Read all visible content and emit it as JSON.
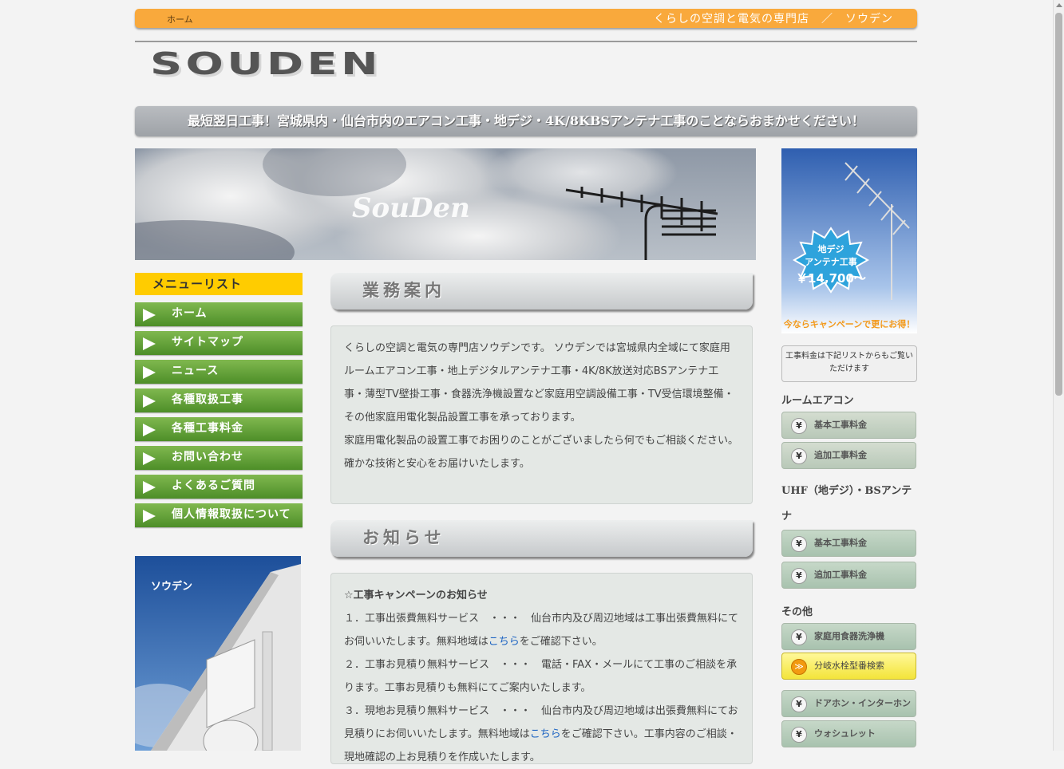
{
  "topbar": {
    "home_link": "ホーム",
    "tagline": "くらしの空調と電気の専門店　／　ソウデン"
  },
  "logo": {
    "text": "SOUDEN"
  },
  "banner": {
    "text": "最短翌日工事！宮城県内・仙台市内のエアコン工事・地デジ・4K/8KBSアンテナ工事のことならおまかせください！"
  },
  "hero": {
    "brand": "SouDen"
  },
  "menu": {
    "title": "メニューリスト",
    "items": [
      "ホーム",
      "サイトマップ",
      "ニュース",
      "各種取扱工事",
      "各種工事料金",
      "お問い合わせ",
      "よくあるご質問",
      "個人情報取扱について"
    ]
  },
  "side_photo": {
    "label": "ソウデン"
  },
  "business": {
    "heading": "業務案内",
    "para1": "くらしの空調と電気の専門店ソウデンです。 ソウデンでは宮城県内全域にて家庭用ルームエアコン工事・地上デジタルアンテナ工事・4K/8K放送対応BSアンテナ工事・薄型TV壁掛工事・食器洗浄機設置など家庭用空調設備工事・TV受信環境整備・その他家庭用電化製品設置工事を承っております。",
    "para2": "家庭用電化製品の設置工事でお困りのことがございましたら何でもご相談ください。",
    "para3": "確かな技術と安心をお届けいたします。"
  },
  "news": {
    "heading": "お知らせ",
    "title": "☆工事キャンペーンのお知らせ",
    "item1_before": "１．工事出張費無料サービス　・・・　仙台市内及び周辺地域は工事出張費無料にてお伺いいたします。無料地域は",
    "item1_link": "こちら",
    "item1_after": "をご確認下さい。",
    "item2": "２．工事お見積り無料サービス　・・・　電話・FAX・メールにて工事のご相談を承ります。工事お見積りも無料にてご案内いたします。",
    "item3_before": "３．現地お見積り無料サービス　・・・　仙台市内及び周辺地域は出張費無料にてお見積りにお伺いいたします。無料地域は",
    "item3_link": "こちら",
    "item3_after": "をご確認下さい。工事内容のご相談・現地確認の上お見積りを作成いたします。"
  },
  "ad": {
    "line1": "地デジ",
    "line2": "アンテナ工事",
    "price": "￥14,700～",
    "campaign": "今ならキャンペーンで更にお得！"
  },
  "right": {
    "info": "工事料金は下記リストからもご覧いただけます",
    "aircon_heading": "ルームエアコン",
    "aircon_basic": "基本工事料金",
    "aircon_extra": "追加工事料金",
    "uhf_heading": "UHF（地デジ）・BSアンテナ",
    "uhf_basic": "基本工事料金",
    "uhf_extra": "追加工事料金",
    "other_heading": "その他",
    "dishwasher": "家庭用食器洗浄機",
    "faucet_search": "分岐水栓型番検索",
    "doorphone": "ドアホン・インターホン",
    "washlet": "ウォシュレット",
    "yen_symbol": "¥",
    "arrow_symbol": "≫"
  },
  "colors": {
    "topbar": "#f9a93c",
    "menu_green": "#5e9c35",
    "menu_title": "#ffcc00",
    "link": "#1a62c2"
  }
}
